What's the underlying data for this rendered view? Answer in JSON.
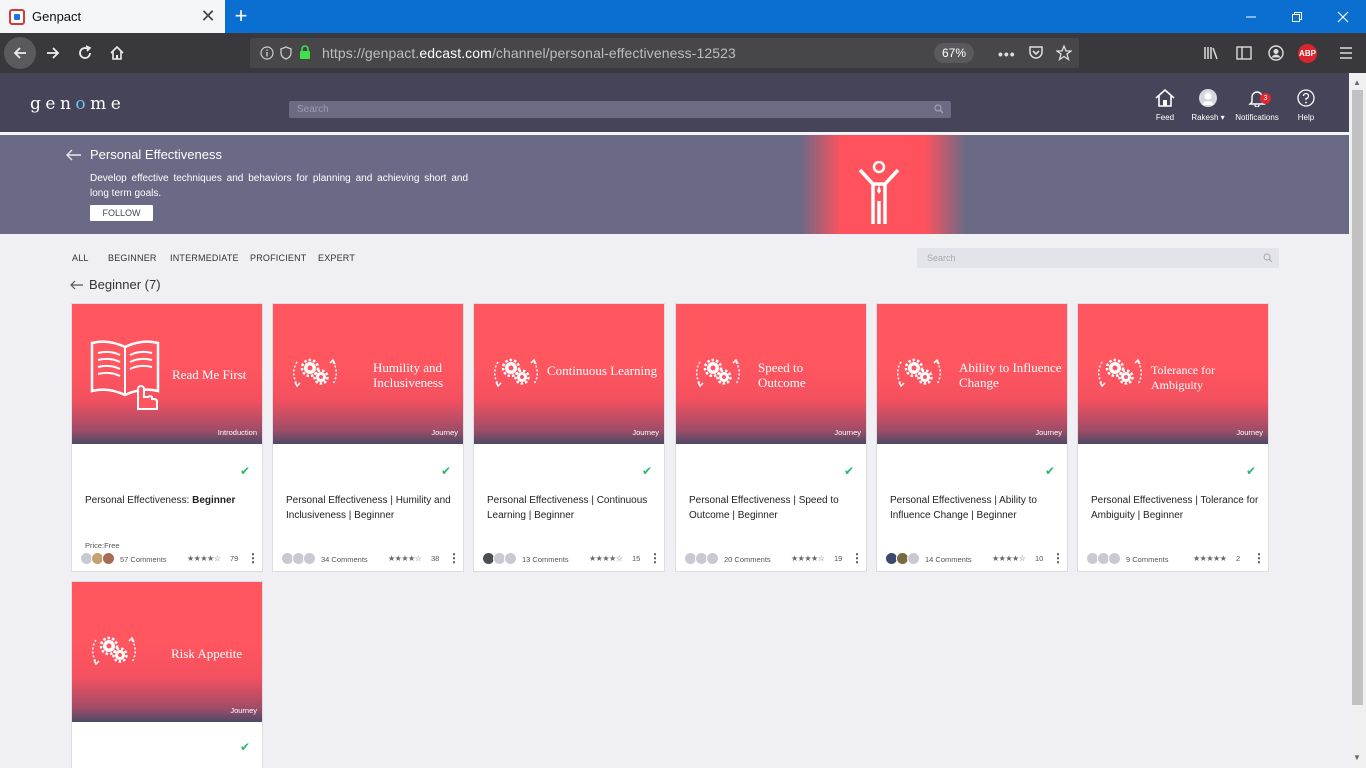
{
  "browser": {
    "tab_title": "Genpact",
    "url_prefix": "https://genpact.",
    "url_domain": "edcast.com",
    "url_path": "/channel/personal-effectiveness-12523",
    "zoom": "67%"
  },
  "header": {
    "logo": "gen",
    "logo_o": "o",
    "logo_end": "me",
    "search_placeholder": "Search",
    "nav": [
      {
        "label": "Feed",
        "icon": "home-icon"
      },
      {
        "label": "Rakesh",
        "icon": "avatar"
      },
      {
        "label": "Notifications",
        "icon": "bell-icon",
        "badge": "3"
      },
      {
        "label": "Help",
        "icon": "help-icon"
      }
    ]
  },
  "channel": {
    "title": "Personal Effectiveness",
    "description": "Develop effective techniques and behaviors for planning and achieving short and long term goals.",
    "follow_label": "FOLLOW"
  },
  "filters": [
    "ALL",
    "BEGINNER",
    "INTERMEDIATE",
    "PROFICIENT",
    "EXPERT"
  ],
  "filter_search_placeholder": "Search",
  "section_title": "Beginner (7)",
  "cards": [
    {
      "image_title": "Read Me First",
      "type": "Introduction",
      "name_prefix": "Personal Effectiveness: ",
      "name_bold": "Beginner",
      "price": "Price:Free",
      "comments": "57 Comments",
      "rating": 4,
      "rating_count": "79"
    },
    {
      "image_title": "Humility and Inclusiveness",
      "type": "Journey",
      "name": "Personal Effectiveness | Humility and Inclusiveness | Beginner",
      "comments": "34 Comments",
      "rating": 4,
      "rating_count": "38"
    },
    {
      "image_title": "Continuous Learning",
      "type": "Journey",
      "name": "Personal Effectiveness | Continuous Learning | Beginner",
      "comments": "13 Comments",
      "rating": 4,
      "rating_count": "15"
    },
    {
      "image_title": "Speed to Outcome",
      "type": "Journey",
      "name": "Personal Effectiveness | Speed to Outcome | Beginner",
      "comments": "20 Comments",
      "rating": 4,
      "rating_count": "19"
    },
    {
      "image_title": "Ability to Influence Change",
      "type": "Journey",
      "name": "Personal Effectiveness | Ability to Influence Change | Beginner",
      "comments": "14 Comments",
      "rating": 4,
      "rating_count": "10"
    },
    {
      "image_title": "Tolerance for Ambiguity",
      "type": "Journey",
      "name": "Personal Effectiveness | Tolerance for Ambiguity | Beginner",
      "comments": "9 Comments",
      "rating": 5,
      "rating_count": "2"
    },
    {
      "image_title": "Risk Appetite",
      "type": "Journey"
    }
  ],
  "colors": {
    "accent": "#ff525d",
    "header": "#454459",
    "banner": "#6a6a86",
    "check": "#2bb673"
  }
}
